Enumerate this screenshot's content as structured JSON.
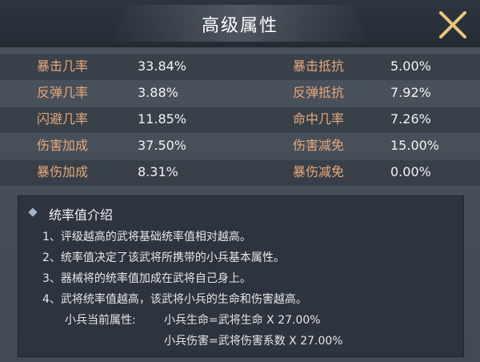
{
  "title": "高级属性",
  "close_icon": "close-x-icon",
  "stats_left": [
    {
      "label": "暴击几率",
      "value": "33.84%"
    },
    {
      "label": "反弹几率",
      "value": "3.88%"
    },
    {
      "label": "闪避几率",
      "value": "11.85%"
    },
    {
      "label": "伤害加成",
      "value": "37.50%"
    },
    {
      "label": "暴伤加成",
      "value": "8.31%"
    }
  ],
  "stats_right": [
    {
      "label": "暴击抵抗",
      "value": "5.00%"
    },
    {
      "label": "反弹抵抗",
      "value": "7.92%"
    },
    {
      "label": "命中几率",
      "value": "7.26%"
    },
    {
      "label": "伤害减免",
      "value": "15.00%"
    },
    {
      "label": "暴伤减免",
      "value": "0.00%"
    }
  ],
  "info": {
    "title": "统率值介绍",
    "lines": [
      "1、评级越高的武将基础统率值相对越高。",
      "2、统率值决定了该武将所携带的小兵基本属性。",
      "3、器械将的统率值加成在武将自己身上。",
      "4、武将统率值越高，该武将小兵的生命和伤害越高。"
    ],
    "formula_label": "小兵当前属性:",
    "formula_1": "小兵生命=武将生命 X 27.00%",
    "formula_2": "小兵伤害=武将伤害系数 X 27.00%"
  },
  "colors": {
    "label": "#e8a87a",
    "value": "#f2f2f2",
    "close": "#e9c67a"
  }
}
